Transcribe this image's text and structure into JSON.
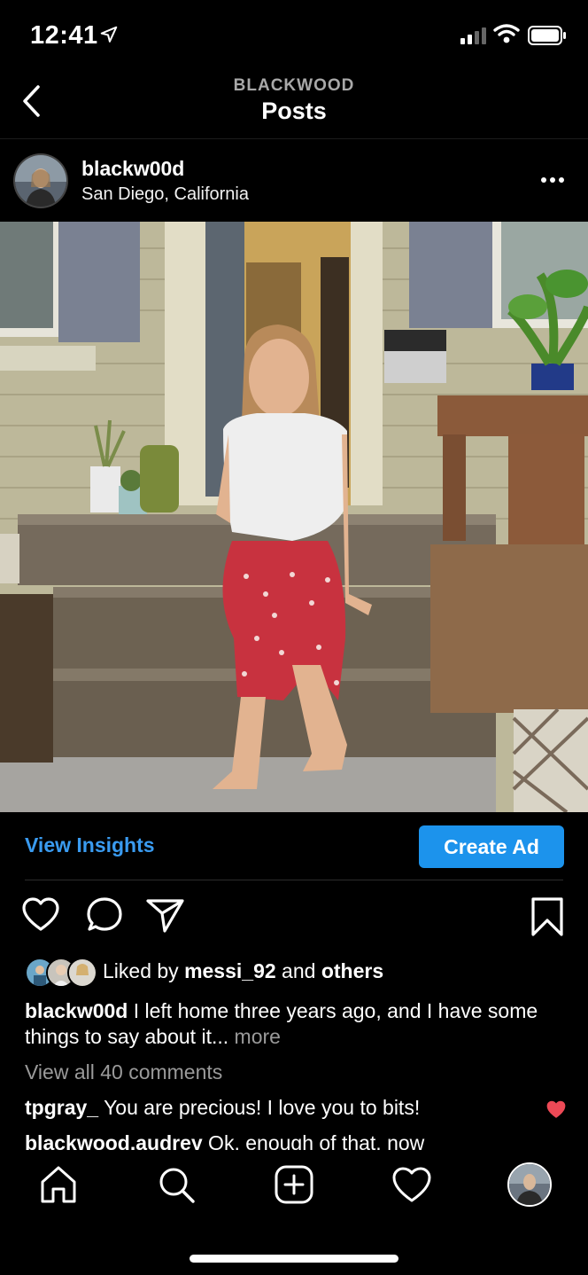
{
  "status": {
    "time": "12:41"
  },
  "header": {
    "account": "BLACKWOOD",
    "title": "Posts"
  },
  "post": {
    "username": "blackw00d",
    "location": "San Diego, California",
    "insights_label": "View Insights",
    "create_ad_label": "Create Ad",
    "likes": {
      "prefix": "Liked by",
      "user": "messi_92",
      "joiner": "and",
      "others": "others"
    },
    "caption": {
      "user": "blackw00d",
      "text": " I left home three years ago, and I have some things to say about it...",
      "more": " more"
    },
    "view_comments": "View all 40 comments",
    "comments": [
      {
        "user": "tpgray_",
        "text": " You are precious! I love you to bits!",
        "liked": true
      },
      {
        "user": "blackwood.audrey",
        "text": " Ok, enough of that, now",
        "liked": false
      }
    ]
  },
  "colors": {
    "accent": "#1c93ec",
    "link": "#3a9bf0",
    "like": "#ed4956"
  },
  "icons": [
    "location-arrow-icon",
    "signal-icon",
    "wifi-icon",
    "battery-icon",
    "back-chevron-icon",
    "more-icon",
    "heart-icon",
    "comment-icon",
    "share-icon",
    "bookmark-icon",
    "home-icon",
    "search-icon",
    "new-post-icon",
    "activity-icon",
    "profile-icon"
  ]
}
